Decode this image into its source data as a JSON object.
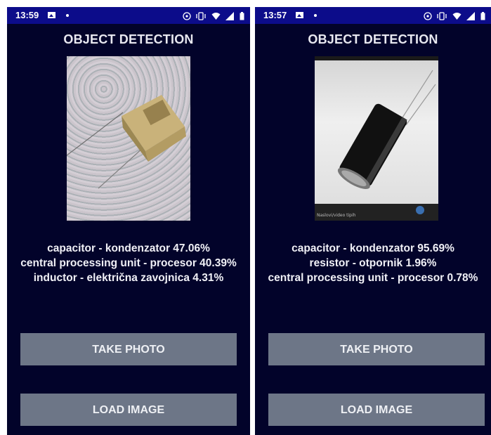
{
  "screens": [
    {
      "status_bar": {
        "time": "13:59"
      },
      "title": "OBJECT DETECTION",
      "results": [
        "capacitor - kondenzator 47.06%",
        "central processing unit - procesor 40.39%",
        "inductor - električna zavojnica 4.31%"
      ],
      "take_photo_label": "TAKE PHOTO",
      "load_image_label": "LOAD IMAGE"
    },
    {
      "status_bar": {
        "time": "13:57"
      },
      "title": "OBJECT DETECTION",
      "photo_caption": "Naslovi/video tipih",
      "results": [
        "capacitor - kondenzator 95.69%",
        "resistor - otpornik 1.96%",
        "central processing unit - procesor 0.78%"
      ],
      "take_photo_label": "TAKE PHOTO",
      "load_image_label": "LOAD IMAGE"
    }
  ],
  "icons": [
    "image-icon",
    "dot-icon",
    "cast-icon",
    "vibrate-icon",
    "wifi-icon",
    "signal-icon",
    "battery-icon"
  ],
  "colors": {
    "status_bar": "#0c0c8a",
    "background": "#02032a",
    "button": "#6d7687",
    "text": "#f0f0f6"
  }
}
